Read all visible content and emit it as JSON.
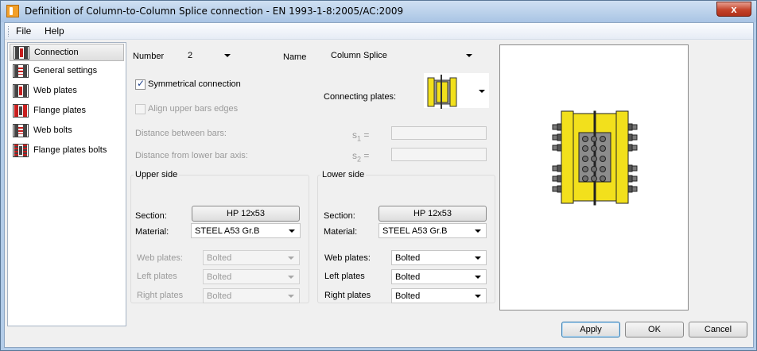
{
  "window": {
    "title": "Definition of Column-to-Column Splice connection - EN 1993-1-8:2005/AC:2009",
    "close_glyph": "x"
  },
  "menu": [
    "File",
    "Help"
  ],
  "sidebar": {
    "items": [
      {
        "label": "Connection",
        "selected": true
      },
      {
        "label": "General settings",
        "selected": false
      },
      {
        "label": "Web plates",
        "selected": false
      },
      {
        "label": "Flange plates",
        "selected": false
      },
      {
        "label": "Web bolts",
        "selected": false
      },
      {
        "label": "Flange plates bolts",
        "selected": false
      }
    ]
  },
  "form": {
    "number_label": "Number",
    "number_value": "2",
    "name_label": "Name",
    "name_value": "Column Splice",
    "symmetrical_label": "Symmetrical connection",
    "symmetrical_checked": true,
    "align_label": "Align upper bars edges",
    "align_checked": false,
    "connecting_plates_label": "Connecting plates:",
    "distance_between_label": "Distance between bars:",
    "distance_between_symbol": "s",
    "distance_between_sub": "1",
    "distance_between_eq": "=",
    "distance_between_value": "",
    "distance_axis_label": "Distance from lower bar axis:",
    "distance_axis_symbol": "s",
    "distance_axis_sub": "2",
    "distance_axis_eq": "=",
    "distance_axis_value": ""
  },
  "upper": {
    "title": "Upper side",
    "section_label": "Section:",
    "section_value": "HP 12x53",
    "material_label": "Material:",
    "material_value": "STEEL A53 Gr.B",
    "web_plates_label": "Web plates:",
    "web_plates_value": "Bolted",
    "left_plates_label": "Left plates",
    "left_plates_value": "Bolted",
    "right_plates_label": "Right plates",
    "right_plates_value": "Bolted"
  },
  "lower": {
    "title": "Lower side",
    "section_label": "Section:",
    "section_value": "HP 12x53",
    "material_label": "Material:",
    "material_value": "STEEL A53 Gr.B",
    "web_plates_label": "Web plates:",
    "web_plates_value": "Bolted",
    "left_plates_label": "Left plates",
    "left_plates_value": "Bolted",
    "right_plates_label": "Right plates",
    "right_plates_value": "Bolted"
  },
  "buttons": {
    "apply": "Apply",
    "ok": "OK",
    "cancel": "Cancel"
  },
  "colors": {
    "plate_yellow": "#f2e01c",
    "web_grey": "#8c8c8c",
    "selected_red": "#c81e1e"
  }
}
